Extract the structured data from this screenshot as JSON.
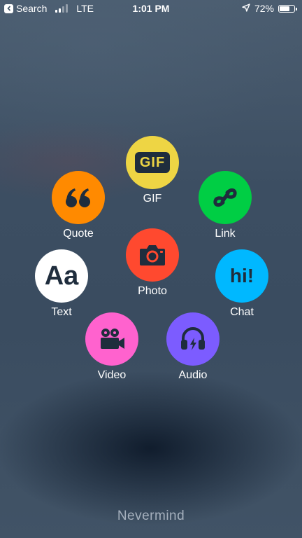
{
  "status_bar": {
    "back_label": "Search",
    "network": "LTE",
    "time": "1:01 PM",
    "battery": "72%",
    "battery_level": 0.72,
    "signal_bars_filled": 2,
    "signal_bars_total": 4
  },
  "actions": [
    {
      "id": "gif",
      "label": "GIF",
      "icon": "gif-icon",
      "icon_text": "GIF",
      "color": "#EED544"
    },
    {
      "id": "quote",
      "label": "Quote",
      "icon": "quote-icon",
      "color": "#FF8A00"
    },
    {
      "id": "link",
      "label": "Link",
      "icon": "link-icon",
      "color": "#00CE44"
    },
    {
      "id": "photo",
      "label": "Photo",
      "icon": "camera-icon",
      "color": "#FF492F"
    },
    {
      "id": "text",
      "label": "Text",
      "icon": "text-icon",
      "icon_text": "Aa",
      "color": "#FFFFFF"
    },
    {
      "id": "chat",
      "label": "Chat",
      "icon": "chat-icon",
      "icon_text": "hi!",
      "color": "#00B8FF"
    },
    {
      "id": "video",
      "label": "Video",
      "icon": "video-camera-icon",
      "color": "#FF62CE"
    },
    {
      "id": "audio",
      "label": "Audio",
      "icon": "headphones-icon",
      "color": "#7C5CFF"
    }
  ],
  "dismiss": {
    "label": "Nevermind"
  },
  "colors": {
    "icon_dark": "#1F2D3D",
    "dismiss_text": "#A5B0BD"
  }
}
